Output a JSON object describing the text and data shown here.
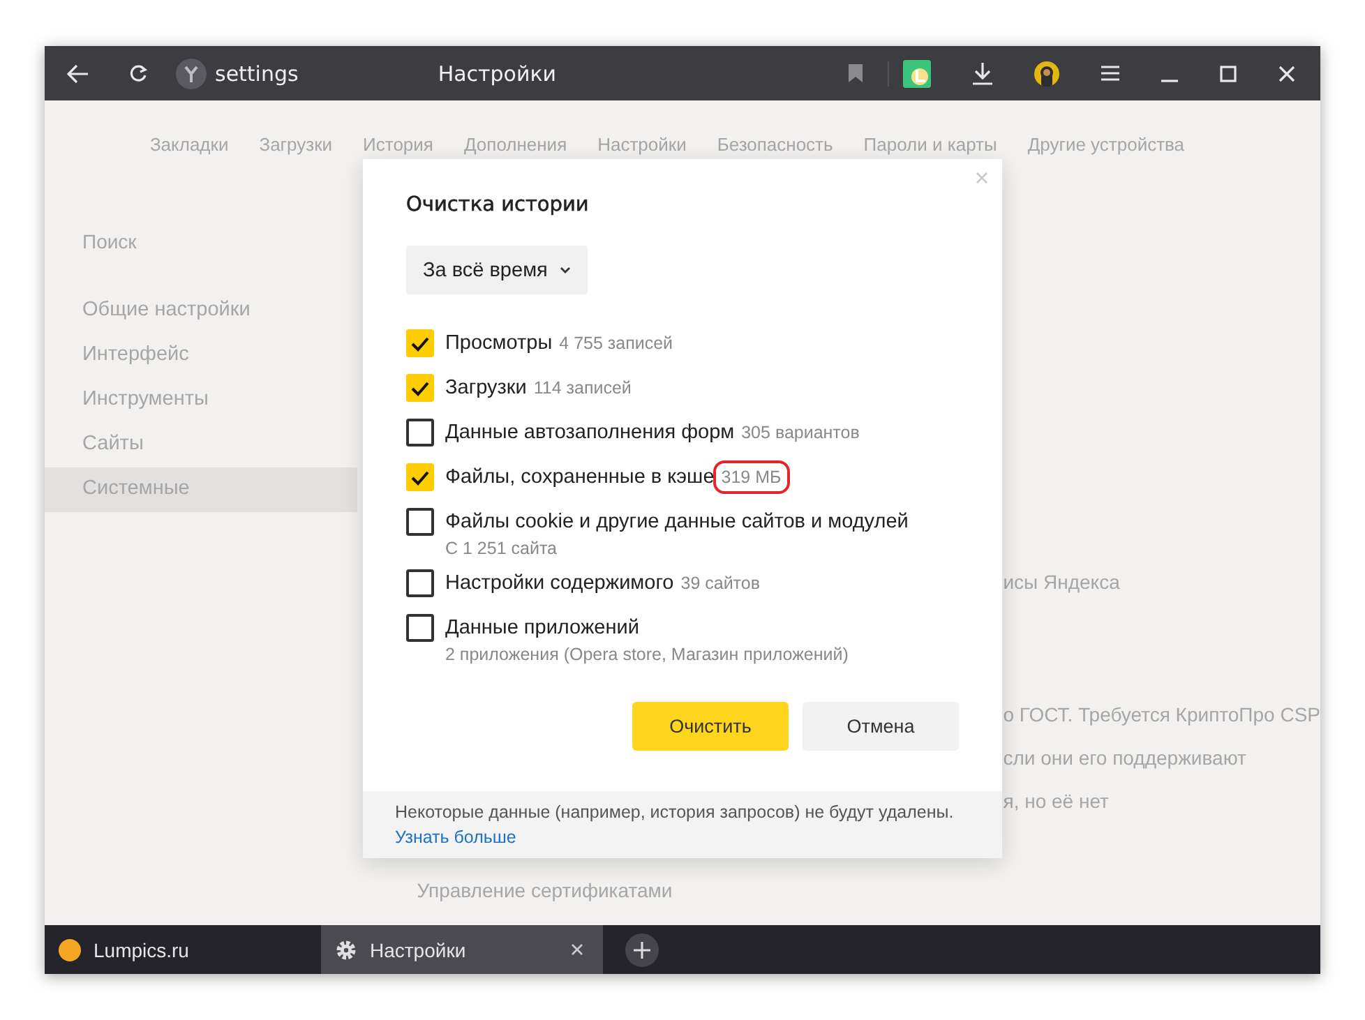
{
  "toolbar": {
    "address": "settings",
    "title": "Настройки"
  },
  "nav_tabs": [
    {
      "label": "Закладки"
    },
    {
      "label": "Загрузки"
    },
    {
      "label": "История"
    },
    {
      "label": "Дополнения"
    },
    {
      "label": "Настройки"
    },
    {
      "label": "Безопасность"
    },
    {
      "label": "Пароли и карты"
    },
    {
      "label": "Другие устройства"
    }
  ],
  "sidebar": {
    "search_placeholder": "Поиск",
    "items": [
      {
        "label": "Общие настройки",
        "selected": false
      },
      {
        "label": "Интерфейс",
        "selected": false
      },
      {
        "label": "Инструменты",
        "selected": false
      },
      {
        "label": "Сайты",
        "selected": false
      },
      {
        "label": "Системные",
        "selected": true
      }
    ]
  },
  "background_text": [
    "исы Яндекса",
    "о ГОСТ. Требуется КриптоПро CSP",
    "сли они его поддерживают",
    "я, но её нет",
    "Управление сертификатами"
  ],
  "dialog": {
    "title": "Очистка истории",
    "period": "За всё время",
    "items": [
      {
        "label": "Просмотры",
        "count": "4 755 записей",
        "checked": true,
        "highlighted": false
      },
      {
        "label": "Загрузки",
        "count": "114 записей",
        "checked": true,
        "highlighted": false
      },
      {
        "label": "Данные автозаполнения форм",
        "count": "305 вариантов",
        "checked": false,
        "highlighted": false
      },
      {
        "label": "Файлы, сохраненные в кэше",
        "count": "319 МБ",
        "checked": true,
        "highlighted": true
      },
      {
        "label": "Файлы cookie и другие данные сайтов и модулей",
        "detail": "С 1 251 сайта",
        "checked": false
      },
      {
        "label": "Настройки содержимого",
        "count": "39 сайтов",
        "checked": false,
        "highlighted": false
      },
      {
        "label": "Данные приложений",
        "detail": "2 приложения (Opera store, Магазин приложений)",
        "checked": false
      }
    ],
    "buttons": [
      {
        "label": "Очистить",
        "kind": "primary"
      },
      {
        "label": "Отмена",
        "kind": "secondary"
      }
    ],
    "note": "Некоторые данные (например, история запросов) не будут удалены.",
    "link": "Узнать больше"
  },
  "tabs": [
    {
      "label": "Lumpics.ru",
      "kind": "site",
      "selected": false
    },
    {
      "label": "Настройки",
      "kind": "settings",
      "selected": true
    }
  ]
}
